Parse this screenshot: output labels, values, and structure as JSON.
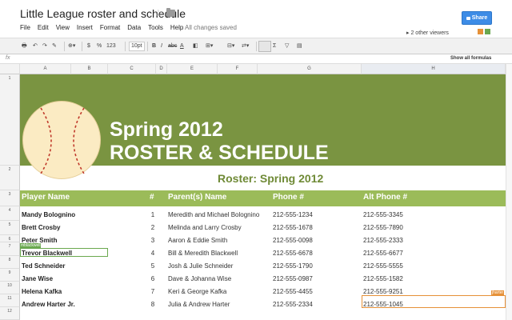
{
  "doc": {
    "title": "Little League roster and schedule",
    "saved_status": "All changes saved"
  },
  "menu": [
    "File",
    "Edit",
    "View",
    "Insert",
    "Format",
    "Data",
    "Tools",
    "Help"
  ],
  "share": {
    "label": "Share"
  },
  "viewers": {
    "text": "2 other viewers",
    "colors": [
      "#e69138",
      "#6aa84f"
    ]
  },
  "toolbar": {
    "currency": "$",
    "percent": "%",
    "number_format": "123",
    "font_size": "10pt",
    "bold": "B",
    "italic": "I",
    "strike": "abc",
    "text_color": "A",
    "sum": "Σ"
  },
  "formula": {
    "fx": "fx",
    "show_all": "Show all formulas"
  },
  "columns": [
    "A",
    "B",
    "C",
    "D",
    "E",
    "F",
    "G",
    "H"
  ],
  "rows": [
    "1",
    "2",
    "3",
    "4",
    "5",
    "6",
    "7",
    "8",
    "9",
    "10",
    "11",
    "12"
  ],
  "banner": {
    "line1": "Spring 2012",
    "line2": "ROSTER & SCHEDULE",
    "color": "#7a9441"
  },
  "subtitle": "Roster: Spring 2012",
  "table": {
    "headers": {
      "player": "Player Name",
      "num": "#",
      "parents": "Parent(s) Name",
      "phone": "Phone #",
      "alt": "Alt Phone #"
    },
    "header_color": "#9bbb59",
    "rows": [
      {
        "name": "Mandy Bolognino",
        "num": "1",
        "parents": "Meredith and Michael Bolognino",
        "phone": "212-555-1234",
        "alt": "212-555-3345"
      },
      {
        "name": "Brett Crosby",
        "num": "2",
        "parents": "Melinda and Larry Crosby",
        "phone": "212-555-1678",
        "alt": "212-555-7890"
      },
      {
        "name": "Peter Smith",
        "num": "3",
        "parents": "Aaron & Eddie Smith",
        "phone": "212-555-0098",
        "alt": "212-555-2333"
      },
      {
        "name": "Trevor Blackwell",
        "num": "4",
        "parents": "Bill & Meredith Blackwell",
        "phone": "212-555-6678",
        "alt": "212-555-6677"
      },
      {
        "name": "Ted Schneider",
        "num": "5",
        "parents": "Josh & Julie Schneider",
        "phone": "212-555-1790",
        "alt": "212-555-5555"
      },
      {
        "name": "Jane Wise",
        "num": "6",
        "parents": "Dave & Johanna Wise",
        "phone": "212-555-0987",
        "alt": "212-555-1582"
      },
      {
        "name": "Helena Kafka",
        "num": "7",
        "parents": "Keri & George Kafka",
        "phone": "212-555-4455",
        "alt": "212-555-9251"
      },
      {
        "name": "Andrew Harter Jr.",
        "num": "8",
        "parents": "Julia & Andrew Harter",
        "phone": "212-555-2334",
        "alt": "212-555-1045"
      }
    ]
  },
  "collab": {
    "green_label": "mblackwell",
    "orange_label": "jharter"
  }
}
